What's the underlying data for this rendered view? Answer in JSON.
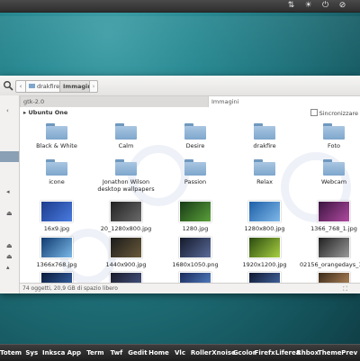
{
  "indicators": [
    "network-updown-icon",
    "brightness-icon",
    "power-icon",
    "no-entry-icon"
  ],
  "indicator_glyphs": [
    "⇅",
    "☀",
    "⏻",
    "⊘"
  ],
  "toolbar": {
    "back_glyph": "‹",
    "forward_glyph": "›",
    "breadcrumb": [
      {
        "label": "drakfire",
        "active": false
      },
      {
        "label": "Immagini",
        "active": true
      }
    ]
  },
  "tabs": [
    {
      "label": "gtk-2.0",
      "active": false
    },
    {
      "label": "Immagini",
      "active": true
    }
  ],
  "place_header": "▸ Ubuntu One",
  "sync_label": "Sincronizzare",
  "items": [
    {
      "type": "folder",
      "label": "Black & White"
    },
    {
      "type": "folder",
      "label": "Calm"
    },
    {
      "type": "folder",
      "label": "Desire"
    },
    {
      "type": "folder",
      "label": "drakfire"
    },
    {
      "type": "folder",
      "label": "Foto"
    },
    {
      "type": "folder",
      "label": "icone"
    },
    {
      "type": "folder",
      "label": "Jonathon Wilson desktop wallpapers"
    },
    {
      "type": "folder",
      "label": "Passion"
    },
    {
      "type": "folder",
      "label": "Relax"
    },
    {
      "type": "folder",
      "label": "Webcam"
    },
    {
      "type": "image",
      "label": "16x9.jpg",
      "colors": [
        "#1b3c8c",
        "#4a7be0"
      ]
    },
    {
      "type": "image",
      "label": "20_1280x800.jpg",
      "colors": [
        "#222",
        "#6a6a6a"
      ]
    },
    {
      "type": "image",
      "label": "1280.jpg",
      "colors": [
        "#173a15",
        "#5aa03a"
      ]
    },
    {
      "type": "image",
      "label": "1280x800.jpg",
      "colors": [
        "#1d5fa8",
        "#7fb8e8"
      ]
    },
    {
      "type": "image",
      "label": "1366_768_1.jpg",
      "colors": [
        "#3a1440",
        "#b04aa0"
      ]
    },
    {
      "type": "image",
      "label": "1366x768.jpg",
      "colors": [
        "#103a70",
        "#7ab8e8"
      ]
    },
    {
      "type": "image",
      "label": "1440x900.jpg",
      "colors": [
        "#1a1a1a",
        "#6a5a3a"
      ]
    },
    {
      "type": "image",
      "label": "1680x1050.png",
      "colors": [
        "#141a2a",
        "#5a6a9a"
      ]
    },
    {
      "type": "image",
      "label": "1920x1200.jpg",
      "colors": [
        "#2a4a10",
        "#a8d040"
      ]
    },
    {
      "type": "image",
      "label": "02156_orangedays_1280x800.jpg",
      "colors": [
        "#202020",
        "#9a9a9a"
      ]
    },
    {
      "type": "image",
      "label": "",
      "colors": [
        "#0a1a3a",
        "#3a6ab0"
      ]
    },
    {
      "type": "image",
      "label": "",
      "colors": [
        "#1a1a2a",
        "#4a5a8a"
      ]
    },
    {
      "type": "image",
      "label": "",
      "colors": [
        "#1a2a5a",
        "#5a8ad0"
      ]
    },
    {
      "type": "image",
      "label": "",
      "colors": [
        "#101830",
        "#4a70b0"
      ]
    },
    {
      "type": "image",
      "label": "",
      "colors": [
        "#3a2a1a",
        "#c09060"
      ]
    }
  ],
  "status_text": "74 oggetti, 20,9 GB di spazio libero",
  "resize_glyph": "⛶",
  "dock": [
    "Totem",
    "Sys",
    "Inksca",
    "App",
    "Term",
    "Twf",
    "Gedit",
    "Home",
    "Vlc",
    "Roller",
    "Xnoise",
    "Gcolor",
    "Firefx",
    "Liferea",
    "Rhbox",
    "Theme",
    "Prev"
  ],
  "sidebar_glyphs": [
    "‹",
    "◂",
    "⏏",
    "⏏",
    "⏏",
    "▴"
  ]
}
